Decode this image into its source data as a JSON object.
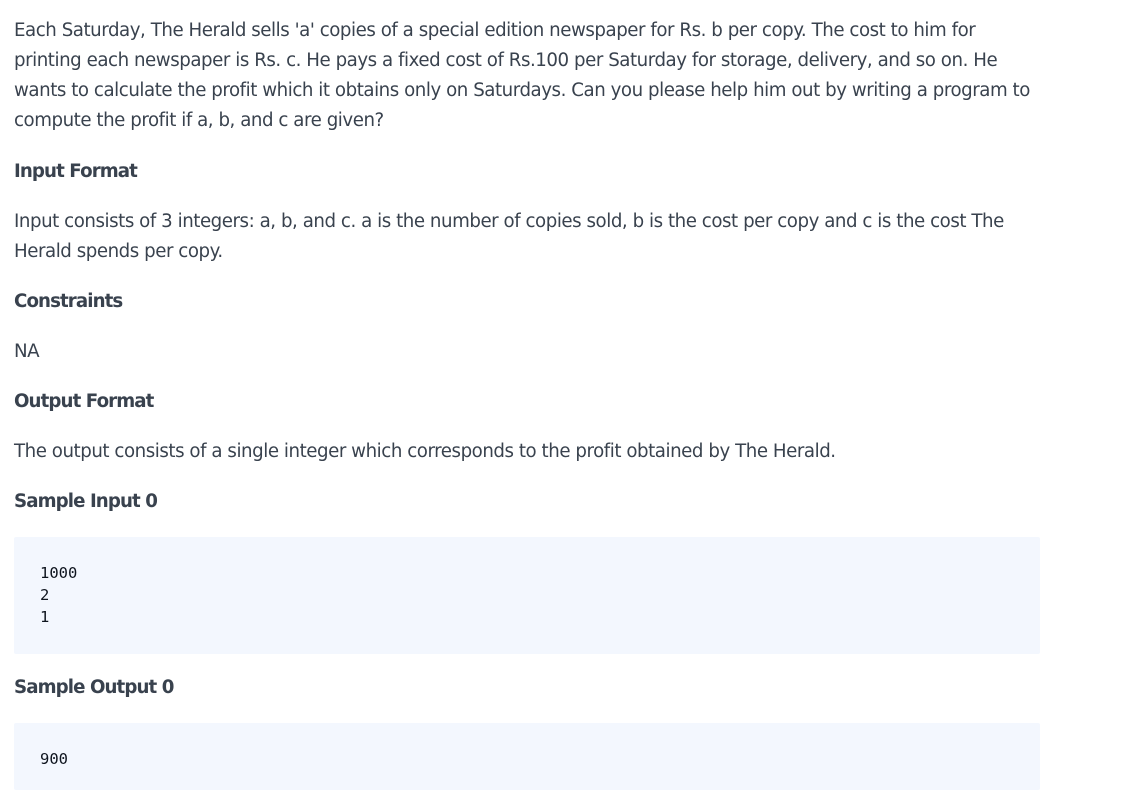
{
  "problem": {
    "statement": "Each Saturday, The Herald sells 'a' copies of a special edition newspaper for Rs. b per copy. The cost to him for printing each newspaper is Rs. c. He pays a fixed cost of Rs.100 per Saturday for storage, delivery, and so on. He wants to calculate the profit which it obtains only on Saturdays. Can you please help him out by writing a program to compute the profit if a, b, and c are given?",
    "sections": {
      "input_format": {
        "title": "Input Format",
        "body": "Input consists of 3 integers: a, b, and c. a is the number of copies sold, b is the cost per copy and c is the cost The Herald spends per copy."
      },
      "constraints": {
        "title": "Constraints",
        "body": "NA"
      },
      "output_format": {
        "title": "Output Format",
        "body": "The output consists of a single integer which corresponds to the profit obtained by The Herald."
      },
      "sample_input": {
        "title": "Sample Input 0",
        "code": "1000\n2\n1"
      },
      "sample_output": {
        "title": "Sample Output 0",
        "code": "900"
      }
    }
  },
  "colors": {
    "text": "#39424e",
    "code_text": "#0e141e",
    "code_background": "#f3f7fe"
  }
}
